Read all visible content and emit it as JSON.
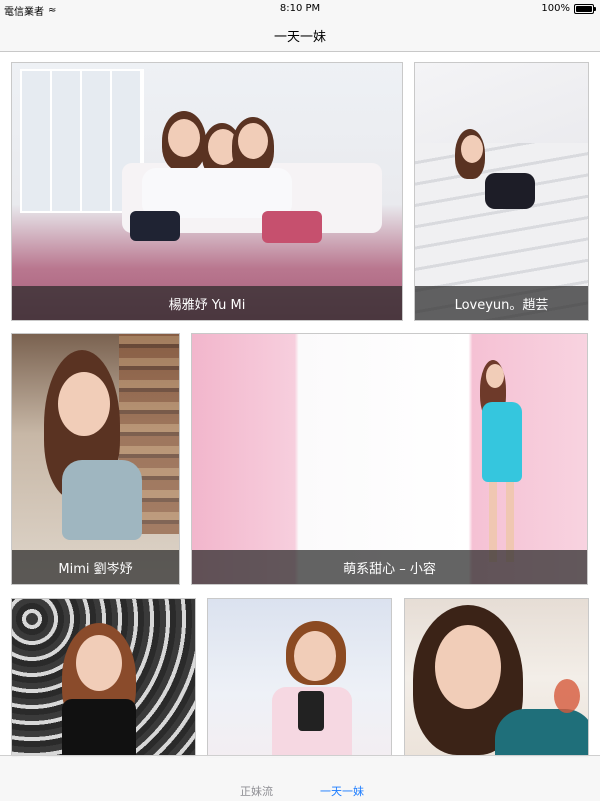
{
  "status_bar": {
    "carrier": "電信業者",
    "time": "8:10 PM",
    "battery": "100%"
  },
  "nav": {
    "title": "一天一妹"
  },
  "cards": [
    {
      "caption": "楊雅妤 Yu Mi"
    },
    {
      "caption": "Loveyun。趙芸"
    },
    {
      "caption": "Mimi 劉岑妤"
    },
    {
      "caption": "萌系甜心 – 小容"
    },
    {
      "caption": ""
    },
    {
      "caption": ""
    },
    {
      "caption": ""
    }
  ],
  "tabs": [
    {
      "label": "正妹流"
    },
    {
      "label": "一天一妹"
    }
  ],
  "colors": {
    "accent": "#1a7bff",
    "caption_bg": "#3a3a3a",
    "bar_bg": "#f7f7f7"
  }
}
